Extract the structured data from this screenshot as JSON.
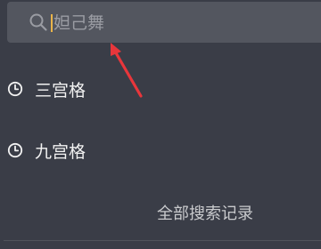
{
  "search": {
    "placeholder": "妲己舞",
    "value": ""
  },
  "history": {
    "items": [
      {
        "label": "三宫格",
        "icon": "clock-icon"
      },
      {
        "label": "九宫格",
        "icon": "clock-icon"
      }
    ],
    "all_history_label": "全部搜索记录"
  },
  "colors": {
    "background": "#3a3d47",
    "search_bar": "#53565f",
    "annotation_arrow": "#e8363b",
    "caret": "#e9b44a"
  }
}
